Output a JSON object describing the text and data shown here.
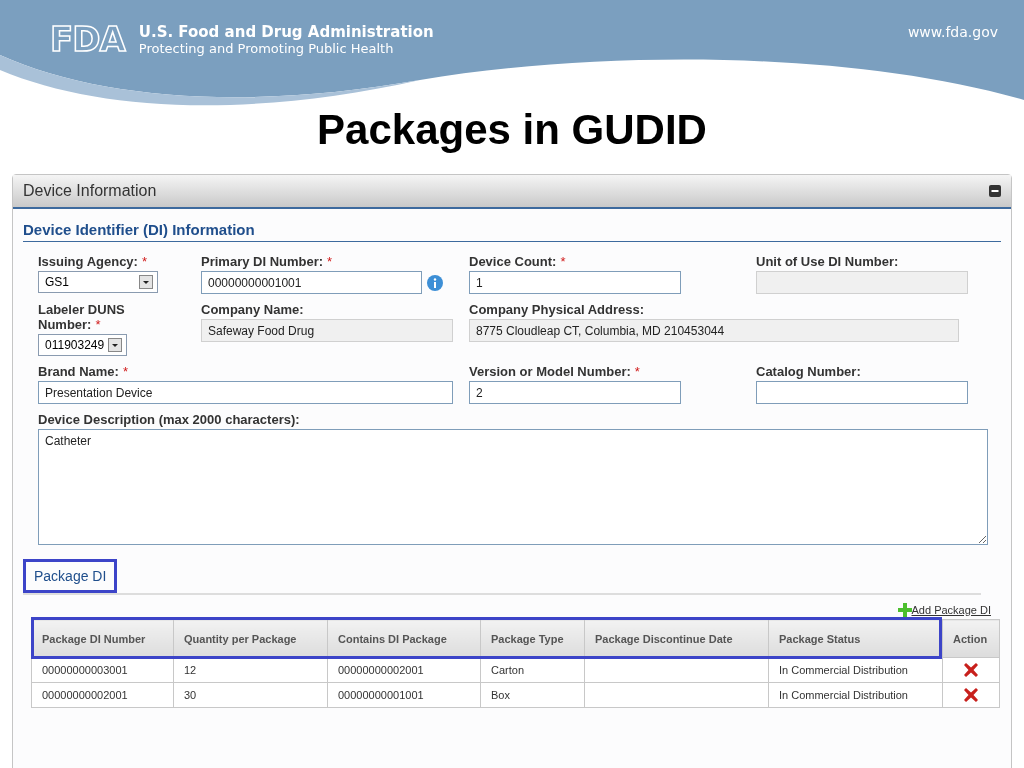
{
  "header": {
    "logo_text": "FDA",
    "agency": "U.S. Food and Drug Administration",
    "tagline": "Protecting and Promoting Public Health",
    "url": "www.fda.gov"
  },
  "slide_title": "Packages in GUDID",
  "panel": {
    "title": "Device Information",
    "expanded": true,
    "section_title": "Device Identifier (DI) Information",
    "fields": [
      {
        "label": "Issuing Agency:",
        "required_mark": "*",
        "kind": "select",
        "value": "GS1"
      },
      {
        "label": "Primary DI Number:",
        "required_mark": "*",
        "kind": "text",
        "value": "00000000001001",
        "info": true
      },
      {
        "label": "Device Count:",
        "required_mark": "*",
        "kind": "text",
        "value": "1"
      },
      {
        "label": "Unit of Use DI Number:",
        "kind": "readonly"
      },
      {
        "label": "Labeler DUNS Number:",
        "required_mark": "*",
        "kind": "select",
        "value": "011903249"
      },
      {
        "label": "Company Name:",
        "kind": "readonly",
        "value": "Safeway Food Drug"
      },
      {
        "label": "Company Physical Address:",
        "kind": "readonly",
        "value": "8775 Cloudleap CT, Columbia, MD 210453044"
      },
      {
        "label": "Brand Name:",
        "required_mark": "*",
        "kind": "text",
        "value": "Presentation Device"
      },
      {
        "label": "Version or Model Number:",
        "required_mark": "*",
        "kind": "text",
        "value": "2"
      },
      {
        "label": "Catalog Number:",
        "kind": "text"
      },
      {
        "label": "Device Description (max 2000 characters):",
        "kind": "textarea",
        "value": "Catheter"
      }
    ],
    "tab": {
      "label": "Package DI",
      "selected": true,
      "highlighted": true
    },
    "add_link": "Add Package DI",
    "table": {
      "header_highlighted": true,
      "columns": [
        {
          "label": "Package DI Number",
          "kind": "data"
        },
        {
          "label": "Quantity per Package",
          "kind": "data"
        },
        {
          "label": "Contains DI Package",
          "kind": "data"
        },
        {
          "label": "Package Type",
          "kind": "data"
        },
        {
          "label": "Package Discontinue Date",
          "kind": "data"
        },
        {
          "label": "Package Status",
          "kind": "data"
        },
        {
          "label": "Action",
          "kind": "action"
        }
      ],
      "rows": [
        {
          "cells": [
            "00000000003001",
            "12",
            "00000000002001",
            "Carton",
            "",
            "In Commercial Distribution"
          ]
        },
        {
          "cells": [
            "00000000002001",
            "30",
            "00000000001001",
            "Box",
            "",
            "In Commercial Distribution"
          ]
        }
      ]
    }
  }
}
